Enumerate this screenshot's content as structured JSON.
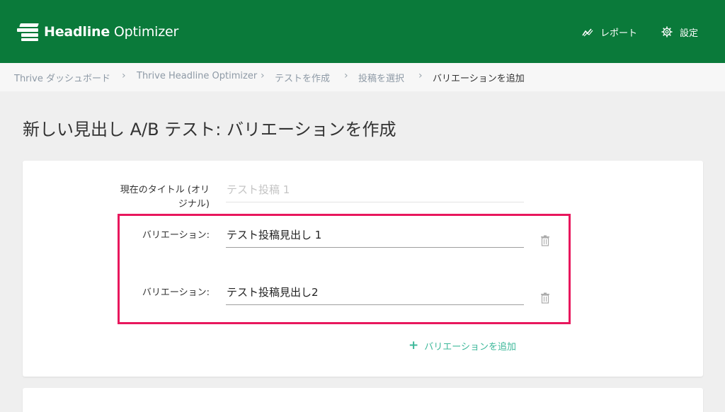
{
  "header": {
    "logo_bold": "Headline",
    "logo_light": " Optimizer",
    "nav": [
      {
        "label": "レポート",
        "icon": "chart-line-icon"
      },
      {
        "label": "設定",
        "icon": "gear-icon"
      }
    ],
    "brand_color": "#0a7a3a"
  },
  "breadcrumb": [
    "Thrive ダッシュボード",
    "Thrive Headline Optimizer",
    "テストを作成",
    "投稿を選択",
    "バリエーションを追加"
  ],
  "page": {
    "title": "新しい見出し A/B テスト: バリエーションを作成"
  },
  "form": {
    "original_label_line1": "現在のタイトル (オリ",
    "original_label_line2": "ジナル)",
    "original_value": "テスト投稿 1",
    "variations": [
      {
        "label": "バリエーション:",
        "value": "テスト投稿見出し 1"
      },
      {
        "label": "バリエーション:",
        "value": "テスト投稿見出し2"
      }
    ],
    "add_variation_label": "バリエーションを追加"
  },
  "colors": {
    "highlight": "#e8175d",
    "link": "#3db89a"
  }
}
